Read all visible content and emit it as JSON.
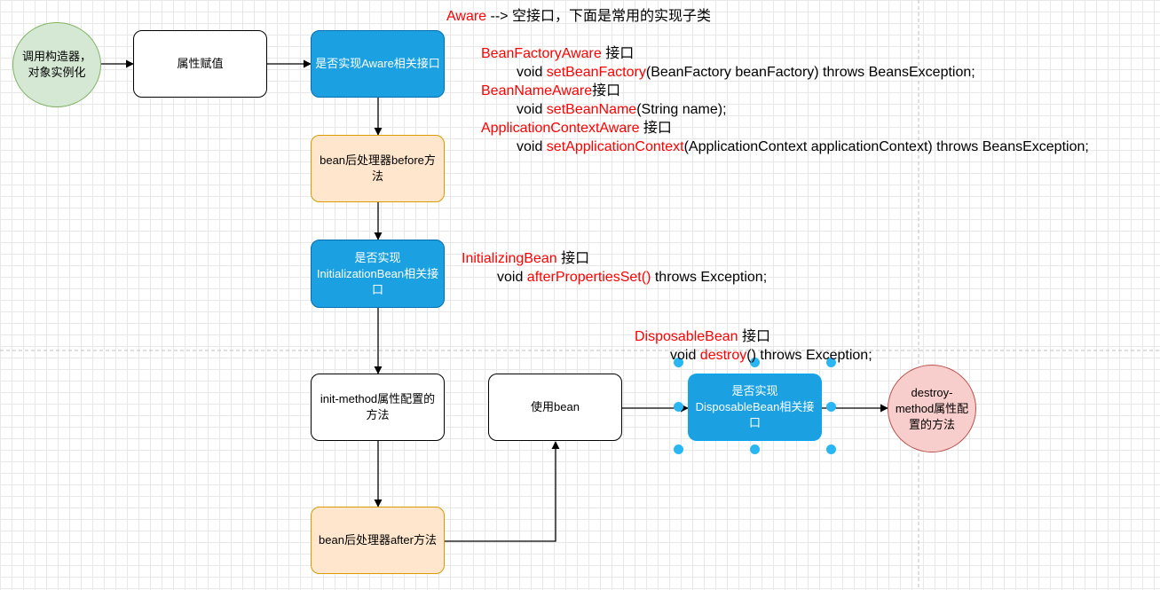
{
  "nodes": {
    "constructor": "调用构造器，对象实例化",
    "populate": "属性赋值",
    "aware_check": "是否实现Aware相关接口",
    "post_before": "bean后处理器before方法",
    "init_bean_check": "是否实现InitializationBean相关接口",
    "init_method": "init-method属性配置的方法",
    "post_after": "bean后处理器after方法",
    "use_bean": "使用bean",
    "disposable_check": "是否实现DisposableBean相关接口",
    "destroy_method": "destroy-method属性配置的方法"
  },
  "notes": {
    "aware_header": {
      "name": "Aware",
      "rest": " --> 空接口，下面是常用的实现子类"
    },
    "aware_list": [
      {
        "iface": "BeanFactoryAware",
        "suffix": " 接口",
        "pre": "void ",
        "method": "setBeanFactory",
        "post": "(BeanFactory beanFactory) throws BeansException;"
      },
      {
        "iface": "BeanNameAware",
        "suffix": "接口",
        "pre": "void ",
        "method": "setBeanName",
        "post": "(String name);"
      },
      {
        "iface": "ApplicationContextAware",
        "suffix": " 接口",
        "pre": "void ",
        "method": "setApplicationContext",
        "post": "(ApplicationContext applicationContext) throws BeansException;"
      }
    ],
    "initializing": {
      "iface": "InitializingBean",
      "suffix": " 接口",
      "pre": "void ",
      "method": "afterPropertiesSet()",
      "post": " throws Exception;"
    },
    "disposable": {
      "iface": "DisposableBean",
      "suffix": " 接口",
      "pre": "void ",
      "method": "destroy",
      "post": "() throws Exception;"
    }
  },
  "colors": {
    "note_highlight": "#ff0000",
    "blue_fill": "#1ba1e2",
    "orange_fill": "#ffe6cc",
    "green_fill": "#d5e8d4",
    "red_fill": "#f8cecc",
    "selection_handle": "#29b6f2"
  }
}
